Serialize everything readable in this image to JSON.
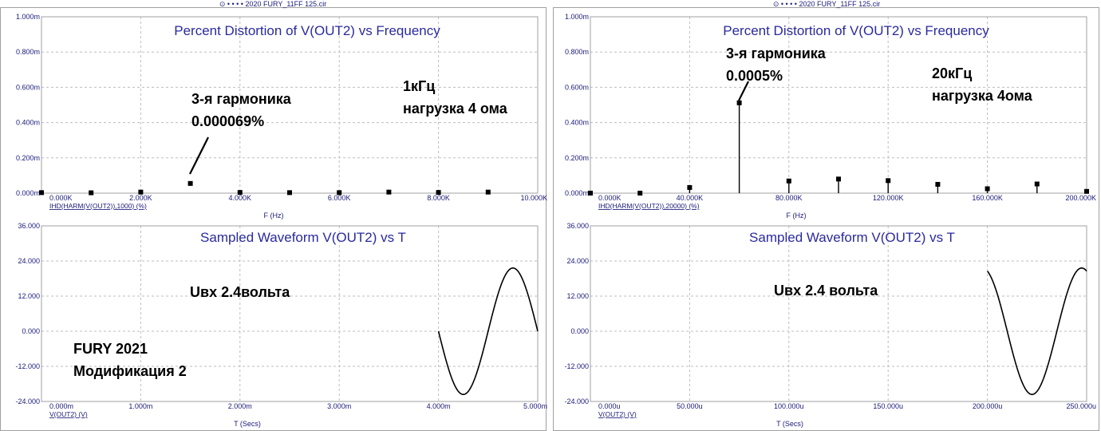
{
  "header": {
    "left": "2020 FURY_11FF 125.cir",
    "right": "2020 FURY_11FF 125.cir"
  },
  "chart_data": [
    {
      "id": "dist1k",
      "type": "scatter",
      "title": "Percent Distortion of V(OUT2) vs Frequency",
      "xlabel": "F (Hz)",
      "series_label": "IHD(HARM(V(OUT2)),1000) (%)",
      "xlim": [
        0,
        10000
      ],
      "ylim": [
        0,
        0.001
      ],
      "x_ticks": [
        "0.000K",
        "2.000K",
        "4.000K",
        "6.000K",
        "8.000K",
        "10.000K"
      ],
      "y_ticks": [
        "0.000m",
        "0.200m",
        "0.400m",
        "0.600m",
        "0.800m",
        "1.000m"
      ],
      "stems": false,
      "x": [
        0,
        1000,
        2000,
        3000,
        4000,
        5000,
        6000,
        7000,
        8000,
        9000
      ],
      "y": [
        3e-06,
        2e-06,
        6e-06,
        5.5e-05,
        4e-06,
        3e-06,
        3e-06,
        6e-06,
        4e-06,
        6e-06
      ],
      "annotations": [
        {
          "lines": [
            "3-я гармоника",
            "0.000069%"
          ]
        },
        {
          "lines": [
            "1кГц",
            "нагрузка 4 ома"
          ]
        }
      ]
    },
    {
      "id": "dist20k",
      "type": "scatter",
      "title": "Percent Distortion of V(OUT2) vs Frequency",
      "xlabel": "F (Hz)",
      "series_label": "IHD(HARM(V(OUT2)),20000) (%)",
      "xlim": [
        0,
        200000
      ],
      "ylim": [
        0,
        0.001
      ],
      "x_ticks": [
        "0.000K",
        "40.000K",
        "80.000K",
        "120.000K",
        "160.000K",
        "200.000K"
      ],
      "y_ticks": [
        "0.000m",
        "0.200m",
        "0.400m",
        "0.600m",
        "0.800m",
        "1.000m"
      ],
      "stems": true,
      "x": [
        0,
        20000,
        40000,
        60000,
        80000,
        100000,
        120000,
        140000,
        160000,
        180000,
        200000
      ],
      "y": [
        3e-07,
        2e-07,
        3.2e-05,
        0.000512,
        6.9e-05,
        8e-05,
        7.1e-05,
        5e-05,
        2.5e-05,
        5.2e-05,
        1e-05
      ],
      "annotations": [
        {
          "lines": [
            "3-я гармоника",
            "0.0005%"
          ]
        },
        {
          "lines": [
            "20кГц",
            "нагрузка 4ома"
          ]
        }
      ]
    },
    {
      "id": "wave1",
      "type": "line",
      "title": "Sampled Waveform  V(OUT2) vs T",
      "xlabel": "T (Secs)",
      "series_label": "V(OUT2) (V)",
      "xlim": [
        0,
        0.005
      ],
      "ylim": [
        -24,
        36
      ],
      "x_ticks": [
        "0.000m",
        "1.000m",
        "2.000m",
        "3.000m",
        "4.000m",
        "5.000m"
      ],
      "y_ticks": [
        "-24.000",
        "-12.000",
        "0.000",
        "12.000",
        "24.000",
        "36.000"
      ],
      "waveform": {
        "amplitude": 21.6,
        "frequency_hz": 1000,
        "t_start": 0.004,
        "t_end": 0.005
      },
      "annotations": [
        {
          "lines": [
            "Uвх  2.4вольта"
          ]
        },
        {
          "lines": [
            "FURY 2021",
            "Модификация 2"
          ]
        }
      ]
    },
    {
      "id": "wave2",
      "type": "line",
      "title": "Sampled Waveform  V(OUT2) vs T",
      "xlabel": "T (Secs)",
      "series_label": "V(OUT2) (V)",
      "xlim": [
        0,
        0.00025
      ],
      "ylim": [
        -24,
        36
      ],
      "x_ticks": [
        "0.000u",
        "50.000u",
        "100.000u",
        "150.000u",
        "200.000u",
        "250.000u"
      ],
      "y_ticks": [
        "-24.000",
        "-12.000",
        "0.000",
        "12.000",
        "24.000",
        "36.000"
      ],
      "waveform": {
        "amplitude": 21.6,
        "frequency_hz": 20000,
        "t_start": 0.0002,
        "t_end": 0.00025,
        "phase_offset": 1e-05
      },
      "annotations": [
        {
          "lines": [
            "Uвх 2.4 вольта"
          ]
        }
      ]
    }
  ]
}
